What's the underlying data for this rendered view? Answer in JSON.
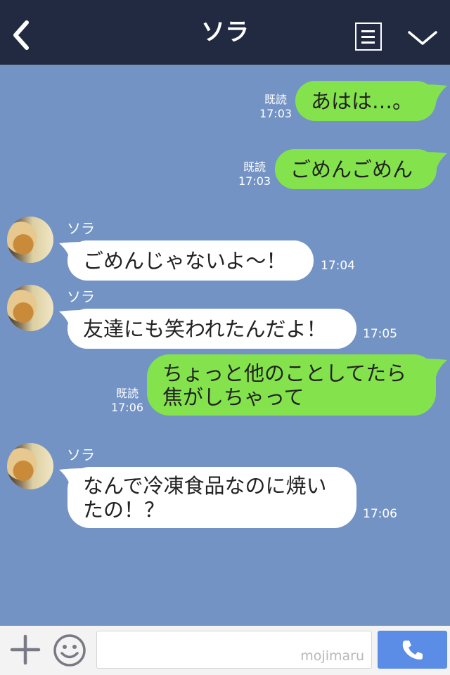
{
  "header": {
    "title": "ソラ",
    "back_icon": "chevron-left-icon",
    "menu_icon": "notes-icon",
    "expand_icon": "chevron-down-icon"
  },
  "messages": [
    {
      "side": "out",
      "text": "あはは…。",
      "read_label": "既読",
      "time": "17:03"
    },
    {
      "side": "out",
      "text": "ごめんごめん",
      "read_label": "既読",
      "time": "17:03"
    },
    {
      "side": "in",
      "sender": "ソラ",
      "text": "ごめんじゃないよ〜！",
      "time": "17:04"
    },
    {
      "side": "in",
      "sender": "ソラ",
      "text": "友達にも笑われたんだよ！",
      "time": "17:05"
    },
    {
      "side": "out",
      "text_line1": "ちょっと他のことしてたら",
      "text_line2": "焦がしちゃって",
      "read_label": "既読",
      "time": "17:06"
    },
    {
      "side": "in",
      "sender": "ソラ",
      "text_line1": "なんで冷凍食品なのに焼い",
      "text_line2": "たの！？",
      "time": "17:06"
    }
  ],
  "footer": {
    "input_value": "",
    "watermark": "mojimaru",
    "plus_icon": "plus-icon",
    "emoji_icon": "smiley-icon",
    "call_icon": "phone-icon"
  },
  "colors": {
    "background": "#7393c5",
    "header": "#222a42",
    "outgoing_bubble": "#84e34c",
    "incoming_bubble": "#ffffff",
    "call_button": "#5b8ce6"
  }
}
